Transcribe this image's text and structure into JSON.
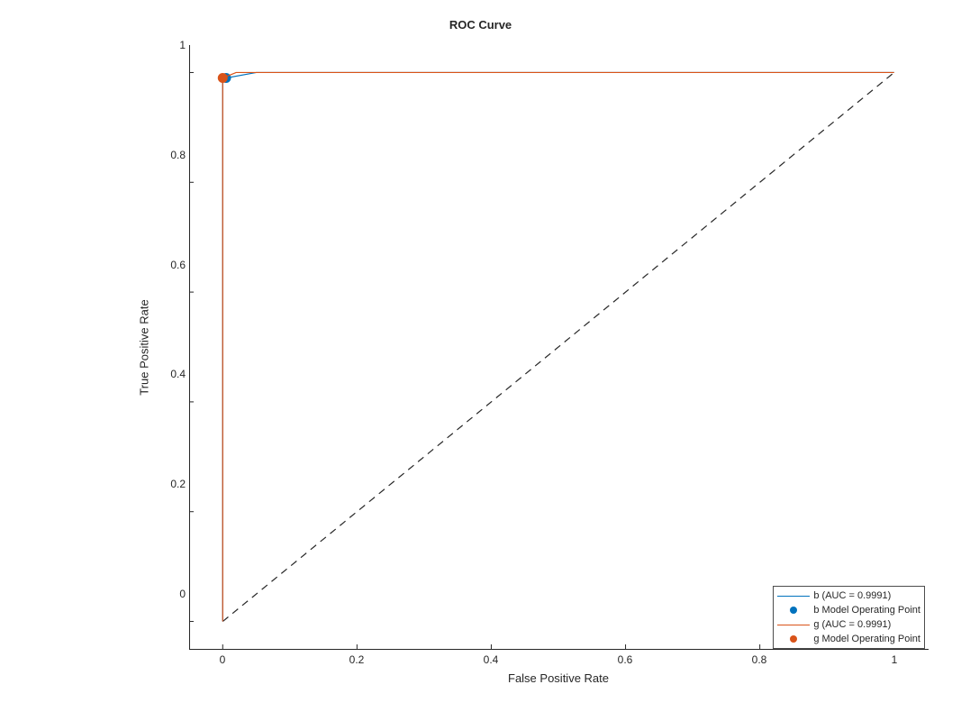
{
  "chart_data": {
    "type": "line",
    "title": "ROC Curve",
    "xlabel": "False Positive Rate",
    "ylabel": "True Positive Rate",
    "xlim": [
      -0.05,
      1.05
    ],
    "ylim": [
      -0.05,
      1.05
    ],
    "xticks": [
      0,
      0.2,
      0.4,
      0.6,
      0.8,
      1
    ],
    "yticks": [
      0,
      0.2,
      0.4,
      0.6,
      0.8,
      1
    ],
    "series": [
      {
        "name": "b",
        "auc": 0.9991,
        "color": "#0072BD",
        "x": [
          0,
          0,
          0,
          0.005,
          0.05,
          1
        ],
        "y": [
          0,
          0.85,
          0.985,
          0.99,
          1,
          1
        ],
        "operating_point": {
          "x": 0.005,
          "y": 0.99
        }
      },
      {
        "name": "g",
        "auc": 0.9991,
        "color": "#D95319",
        "x": [
          0,
          0,
          0.02,
          1
        ],
        "y": [
          0,
          0.99,
          1,
          1
        ],
        "operating_point": {
          "x": 0.0,
          "y": 0.99
        }
      }
    ],
    "reference_line": {
      "x": [
        0,
        1
      ],
      "y": [
        0,
        1
      ],
      "style": "dashed",
      "color": "#262626"
    },
    "legend": {
      "position": "southeast",
      "entries": [
        {
          "kind": "line",
          "color": "#0072BD",
          "label": "b (AUC = 0.9991)"
        },
        {
          "kind": "marker",
          "color": "#0072BD",
          "label": "b Model Operating Point"
        },
        {
          "kind": "line",
          "color": "#D95319",
          "label": "g (AUC = 0.9991)"
        },
        {
          "kind": "marker",
          "color": "#D95319",
          "label": "g Model Operating Point"
        }
      ]
    }
  }
}
